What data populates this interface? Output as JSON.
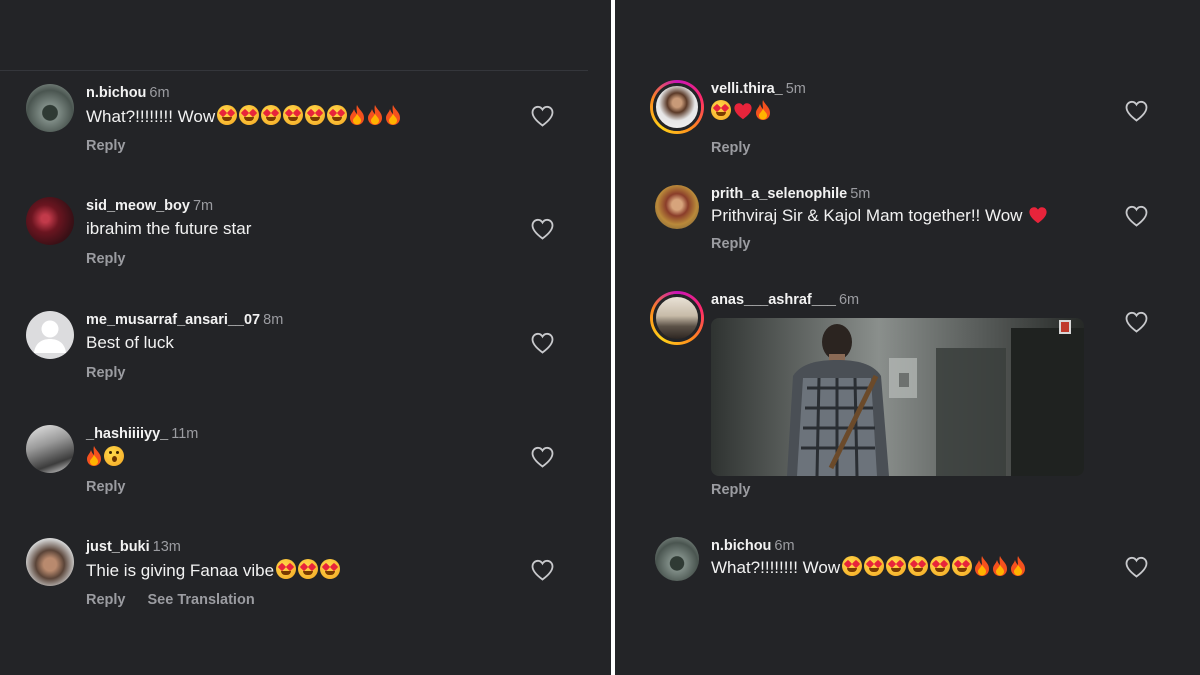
{
  "reply_label": "Reply",
  "see_translation_label": "See Translation",
  "left_comments": [
    {
      "username": "n.bichou",
      "time": "6m",
      "text": "What?!!!!!!!! Wow"
    },
    {
      "username": "sid_meow_boy",
      "time": "7m",
      "text": "ibrahim the future star"
    },
    {
      "username": "me_musarraf_ansari__07",
      "time": "8m",
      "text": "Best of luck"
    },
    {
      "username": "_hashiiiiyy_",
      "time": "11m",
      "text": ""
    },
    {
      "username": "just_buki",
      "time": "13m",
      "text": "Thie is giving Fanaa vibe"
    }
  ],
  "right_comments": [
    {
      "username": "velli.thira_",
      "time": "5m",
      "text": ""
    },
    {
      "username": "prith_a_selenophile",
      "time": "5m",
      "text": "Prithviraj Sir & Kajol Mam together!! Wow"
    },
    {
      "username": "anas___ashraf___",
      "time": "6m",
      "text": ""
    },
    {
      "username": "n.bichou",
      "time": "6m",
      "text": "What?!!!!!!!! Wow"
    }
  ],
  "icons": {
    "like": "heart-outline-icon",
    "emoji_heart_eyes": "heart-eyes-emoji",
    "emoji_fire": "fire-emoji",
    "emoji_red_heart": "red-heart-emoji",
    "emoji_wow": "astonished-face-emoji"
  },
  "colors": {
    "background": "#232427",
    "username": "#f2f2f2",
    "secondary": "#9b9ca1",
    "story_ring": "#ff2a68"
  }
}
